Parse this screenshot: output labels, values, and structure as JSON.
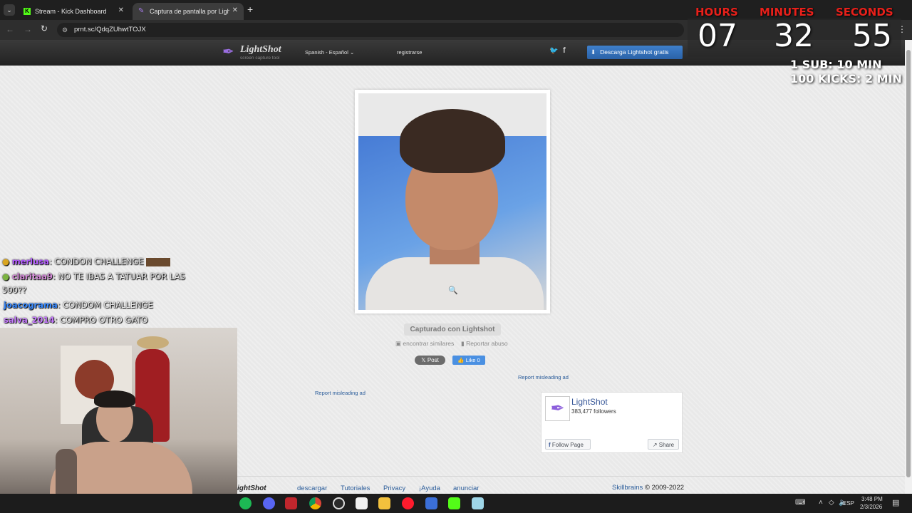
{
  "browser": {
    "tabs": [
      {
        "title": "Stream - Kick Dashboard",
        "active": false
      },
      {
        "title": "Captura de pantalla por Lightsh",
        "active": true
      }
    ],
    "new_tab": "+",
    "url": "prnt.sc/QdqZUhwtTOJX"
  },
  "lightshot": {
    "logo": "LightShot",
    "logo_sub": "screen capture tool",
    "language": "Spanish - Español",
    "register": "registrarse",
    "download_btn": "Descarga Lightshot gratis",
    "caption": "Capturado con Lightshot",
    "find_similar": "encontrar similares",
    "report_abuse": "Reportar abuso",
    "tweet": "Post",
    "like": "Like 0",
    "report_ad_1": "Report misleading ad",
    "report_ad_2": "Report misleading ad",
    "fb_page": {
      "name": "LightShot",
      "followers": "383,477 followers",
      "follow": "Follow Page",
      "share": "Share"
    },
    "footer": {
      "logo": "ightShot",
      "links": [
        "descargar",
        "Tutoriales",
        "Privacy",
        "¡Ayuda",
        "anunciar"
      ],
      "brand": "Skillbrains",
      "copyright": "© 2009-2022"
    }
  },
  "overlay": {
    "timer": {
      "hours_label": "HOURS",
      "minutes_label": "MINUTES",
      "seconds_label": "SECONDS",
      "hours": "07",
      "minutes": "32",
      "seconds": "55"
    },
    "rules": [
      "1 SUB: 10 MIN",
      "100 KICKS: 2 MIN"
    ],
    "chat": [
      {
        "user": "merlusa",
        "msg": ": CONDON CHALLENGE",
        "color": "#b35cff"
      },
      {
        "user": "claritaa9",
        "msg": ": NO TE IBAS A TATUAR POR LAS",
        "color": "#d48ad8"
      },
      {
        "user": "",
        "msg": "500??",
        "color": "#e8e8e8"
      },
      {
        "user": "joacograma",
        "msg": ": CONDOM CHALLENGE",
        "color": "#3a8bff"
      },
      {
        "user": "salva_2014",
        "msg": ": COMPRO OTRO GATO",
        "color": "#c77dff"
      }
    ]
  },
  "taskbar": {
    "lang": "ESP",
    "time": "3:48 PM",
    "date": "2/3/2026"
  },
  "colors": {
    "accent_blue": "#2f6db5",
    "timer_red": "#e8201a",
    "kick_green": "#53fc18"
  }
}
